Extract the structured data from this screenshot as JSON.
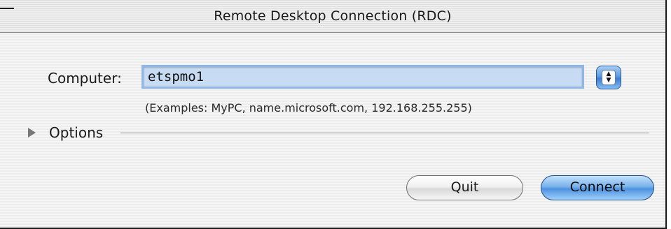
{
  "window": {
    "title": "Remote Desktop Connection (RDC)"
  },
  "form": {
    "computer_label": "Computer:",
    "computer_value": "etspmo1",
    "examples_text": "(Examples: MyPC, name.microsoft.com, 192.168.255.255)"
  },
  "options": {
    "label": "Options",
    "expanded": false
  },
  "buttons": {
    "quit_label": "Quit",
    "connect_label": "Connect"
  },
  "icons": {
    "stepper": "up-down-arrows-icon",
    "stepper_glyph": "▲\n▼",
    "disclosure": "disclosure-triangle-right-icon"
  },
  "colors": {
    "accent": "#5d9ae0",
    "input_highlight": "#c7dcf3"
  }
}
